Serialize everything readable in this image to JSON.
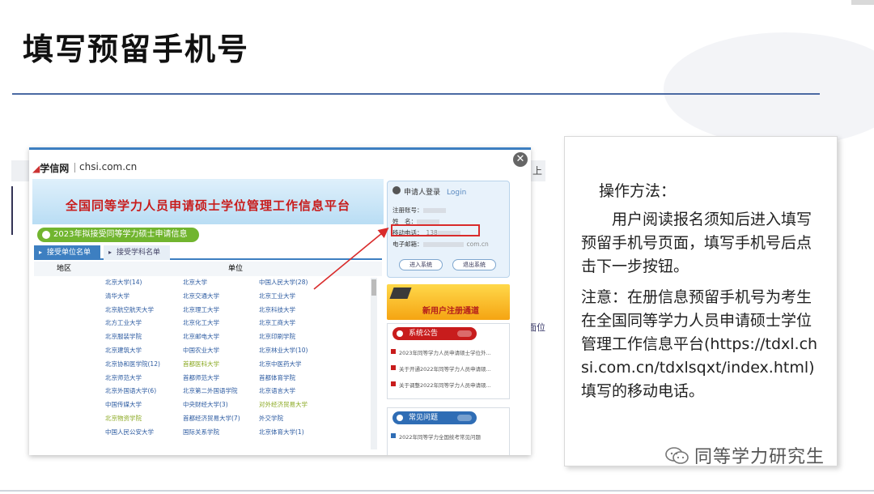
{
  "slide": {
    "title": "填写预留手机号"
  },
  "screenshot": {
    "background_right_text": "上",
    "background_side_text": "面位",
    "site": {
      "logo_mark": "◢",
      "logo_text": "学信网",
      "domain": "chsi.com.cn"
    },
    "banner_title": "全国同等学力人员申请硕士学位管理工作信息平台",
    "section_title": "2023年拟接受同等学力硕士申请信息",
    "tabs": [
      "接受单位名单",
      "接受学科名单"
    ],
    "columns": [
      "地区",
      "单位"
    ],
    "schools": [
      [
        "北京大学(14)",
        "北京大学",
        "中国人民大学(28)"
      ],
      [
        "清华大学",
        "北京交通大学",
        "北京工业大学"
      ],
      [
        "北京航空航天大学",
        "北京理工大学",
        "北京科技大学"
      ],
      [
        "北方工业大学",
        "北京化工大学",
        "北京工商大学"
      ],
      [
        "北京服装学院",
        "北京邮电大学",
        "北京印刷学院"
      ],
      [
        "北京建筑大学",
        "中国农业大学",
        "北京林业大学(10)"
      ],
      [
        "北京协和医学院(12)",
        "首都医科大学",
        "北京中医药大学"
      ],
      [
        "北京师范大学",
        "首都师范大学",
        "首都体育学院"
      ],
      [
        "北京外国语大学(6)",
        "北京第二外国语学院",
        "北京语言大学"
      ],
      [
        "中国传媒大学",
        "中央财经大学(3)",
        "对外经济贸易大学"
      ],
      [
        "北京物资学院",
        "首都经济贸易大学(7)",
        "外交学院"
      ],
      [
        "中国人民公安大学",
        "国际关系学院",
        "北京体育大学(1)"
      ]
    ],
    "login": {
      "heading": "申请人登录",
      "heading_en": "Login",
      "fields": [
        {
          "label": "注册账号：",
          "value": ""
        },
        {
          "label": "姓　名：",
          "value": ""
        },
        {
          "label": "移动电话：",
          "value": "138"
        },
        {
          "label": "电子邮箱：",
          "value": "com.cn"
        }
      ],
      "enter_button": "进入系统",
      "exit_button": "退出系统"
    },
    "register_label": "新用户注册通道",
    "announcements": {
      "heading": "系统公告",
      "items": [
        "2023年同等学力人员申请硕士学位外...",
        "关于开通2022年同等学力人员申请硕...",
        "关于调整2022年同等学力人员申请硕..."
      ]
    },
    "faq": {
      "heading": "常见问题",
      "items": [
        "2022年同等学力全国统考常见问题"
      ]
    }
  },
  "instructions": {
    "heading": "操作方法：",
    "paragraph1": "用户阅读报名须知后进入填写预留手机号页面，填写手机号后点击下一步按钮。",
    "paragraph2": "注意：在册信息预留手机号为考生在全国同等学力人员申请硕士学位管理工作信息平台(https://tdxl.chsi.com.cn/tdxlsqxt/index.html)填写的移动电话。"
  },
  "watermark": "同等学力研究生",
  "colors": {
    "title_rule": "#4b6aa3",
    "banner_red": "#c81c1c",
    "accent_blue": "#3d7fc1",
    "section_green": "#71b52f",
    "highlight_red": "#d92b2b"
  }
}
